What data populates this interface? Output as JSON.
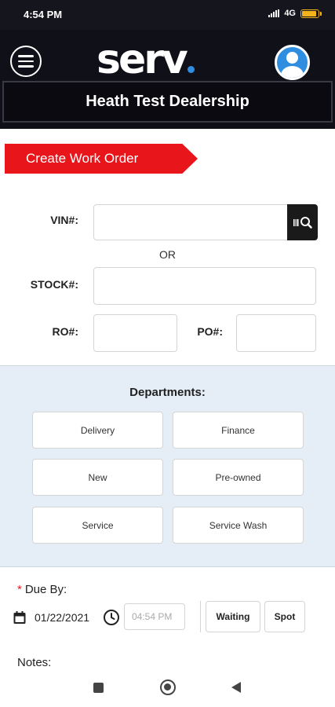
{
  "status_bar": {
    "time": "4:54 PM",
    "network": "4G",
    "battery_level": 0.9
  },
  "header": {
    "logo_text": "serv",
    "dealership_name": "Heath Test Dealership",
    "menu_icon": "hamburger-menu-icon",
    "profile_icon": "user-avatar-icon"
  },
  "page": {
    "section_title": "Create Work Order"
  },
  "form": {
    "vin_label": "VIN#:",
    "vin_value": "",
    "or_text": "OR",
    "stock_label": "STOCK#:",
    "stock_value": "",
    "ro_label": "RO#:",
    "ro_value": "",
    "po_label": "PO#:",
    "po_value": ""
  },
  "departments": {
    "title": "Departments:",
    "items": [
      "Delivery",
      "Finance",
      "New",
      "Pre-owned",
      "Service",
      "Service Wash"
    ]
  },
  "due_by": {
    "label": "Due By:",
    "date": "01/22/2021",
    "time_placeholder": "04:54 PM",
    "options": [
      "Waiting",
      "Spot"
    ]
  },
  "notes_label": "Notes:",
  "colors": {
    "accent_red": "#e8151a",
    "brand_blue": "#2f8ee0",
    "header_bg": "#101018",
    "dept_panel_bg": "#e5edf6"
  }
}
